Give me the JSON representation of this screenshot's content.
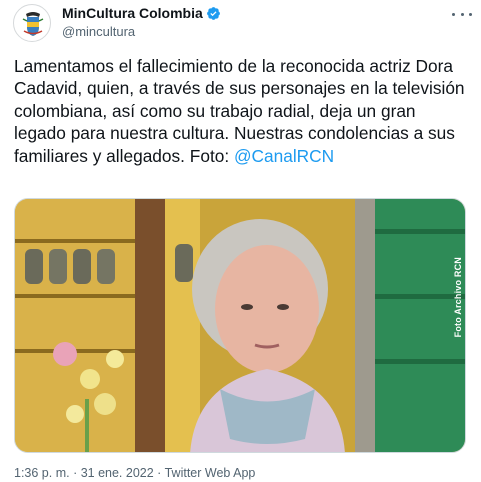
{
  "account": {
    "display_name": "MinCultura Colombia",
    "handle": "@mincultura",
    "verified_icon": "verified-badge-icon",
    "avatar_icon": "colombia-coat-of-arms-icon"
  },
  "tweet": {
    "text": "Lamentamos el fallecimiento de la reconocida actriz Dora Cadavid, quien, a través de sus personajes en la televisión colombiana, así como su trabajo radial, deja un gran legado para nuestra cultura. Nuestras condolencias a sus familiares y allegados. Foto: ",
    "mention": "@CanalRCN"
  },
  "media": {
    "photo_credit": "Foto Archivo RCN"
  },
  "meta": {
    "time": "1:36 p. m.",
    "separator": " · ",
    "date": "31 ene. 2022",
    "source": "Twitter Web App"
  },
  "colors": {
    "link": "#1d9bf0",
    "secondary_text": "#536471",
    "verified": "#1d9bf0"
  }
}
